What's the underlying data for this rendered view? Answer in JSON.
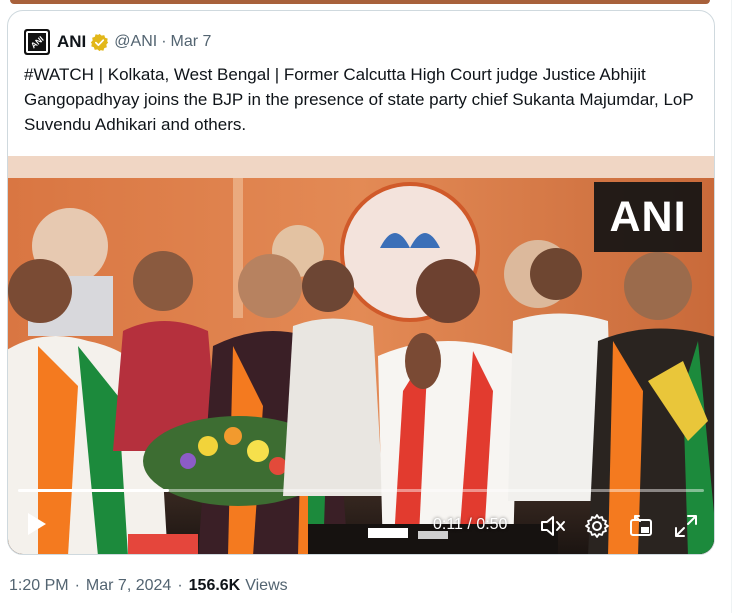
{
  "quoted_tweet": {
    "author_name": "ANI",
    "author_handle": "@ANI",
    "separator": "·",
    "date": "Mar 7",
    "verified": true,
    "text": "#WATCH | Kolkata, West Bengal | Former Calcutta High Court judge Justice Abhijit Gangopadhyay joins the BJP in the presence of state party chief Sukanta Majumdar, LoP Suvendu Adhikari and others.",
    "avatar_text": "ANI"
  },
  "video": {
    "watermark": "ANI",
    "current_time": "0:11",
    "time_separator": "/",
    "duration": "0:50",
    "progress_fraction": 0.22,
    "icons": [
      "play-icon",
      "mute-icon",
      "settings-icon",
      "pip-icon",
      "fullscreen-icon"
    ]
  },
  "footer": {
    "time": "1:20 PM",
    "separator": "·",
    "date": "Mar 7, 2024",
    "views_count": "156.6K",
    "views_label": "Views"
  },
  "colors": {
    "verified_gold": "#e2b719",
    "text_primary": "#0f1419",
    "text_secondary": "#536471",
    "saffron": "#f47a1f",
    "bjp_green": "#1c8a3c"
  }
}
